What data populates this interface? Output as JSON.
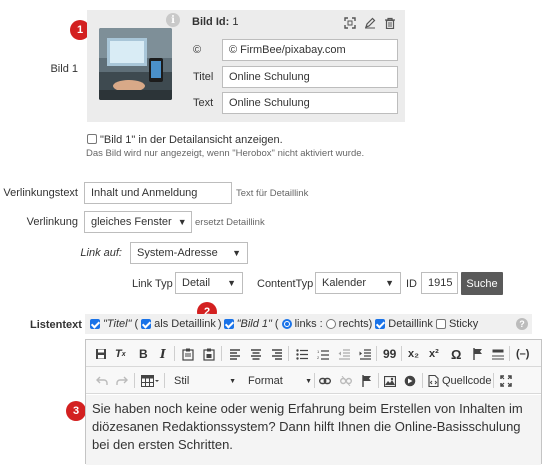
{
  "badges": [
    "1",
    "2",
    "3"
  ],
  "image": {
    "section_label": "Bild 1",
    "id_label": "Bild Id:",
    "id_value": "1",
    "copyright_label": "©",
    "copyright_value": "© FirmBee/pixabay.com",
    "title_label": "Titel",
    "title_value": "Online Schulung",
    "text_label": "Text",
    "text_value": "Online Schulung",
    "info_glyph": "i",
    "icons": [
      "crop-icon",
      "pencil-icon",
      "trash-icon"
    ]
  },
  "detail_checkbox": {
    "label": "\"Bild 1\" in der Detailansicht anzeigen.",
    "checked": false,
    "hint": "Das Bild wird nur angezeigt, wenn \"Herobox\" nicht aktiviert wurde."
  },
  "linking": {
    "text_label": "Verlinkungstext",
    "text_value": "Inhalt und Anmeldung",
    "text_hint": "Text für Detaillink",
    "target_label": "Verlinkung",
    "target_value": "gleiches Fenster",
    "target_hint": "ersetzt Detaillink",
    "link_on_label": "Link auf:",
    "link_on_value": "System-Adresse",
    "link_type_label": "Link Typ",
    "link_type_value": "Detail",
    "content_type_label": "ContentTyp",
    "content_type_value": "Kalender",
    "id_label": "ID",
    "id_value": "1915",
    "search_button": "Suche"
  },
  "listtext": {
    "label": "Listentext",
    "titel_label": "\"Titel\"",
    "paren_open": "(",
    "as_detaillink_label": "als Detaillink",
    "paren_close": ")",
    "bild_label": "\"Bild 1\"",
    "bild_paren_open": "(",
    "links_label": "links",
    "sep": ":",
    "rechts_label": "rechts)",
    "detaillink_label": "Detaillink",
    "sticky_label": "Sticky",
    "help_glyph": "?"
  },
  "editor": {
    "style_label": "Stil",
    "format_label": "Format",
    "source_label": "Quellcode",
    "quote_glyph": "99",
    "omega_glyph": "Ω",
    "sub_glyph": "x₂",
    "sup_glyph": "x²",
    "content": "Sie haben noch keine oder wenig Erfahrung beim Erstellen von Inhalten im diözesanen Redaktionssystem? Dann hilft Ihnen die Online-Basisschulung bei den ersten Schritten."
  },
  "colors": {
    "badge": "#d32020",
    "checkbox": "#1a73e8",
    "panel": "#ececec",
    "button": "#5a5a5a"
  }
}
